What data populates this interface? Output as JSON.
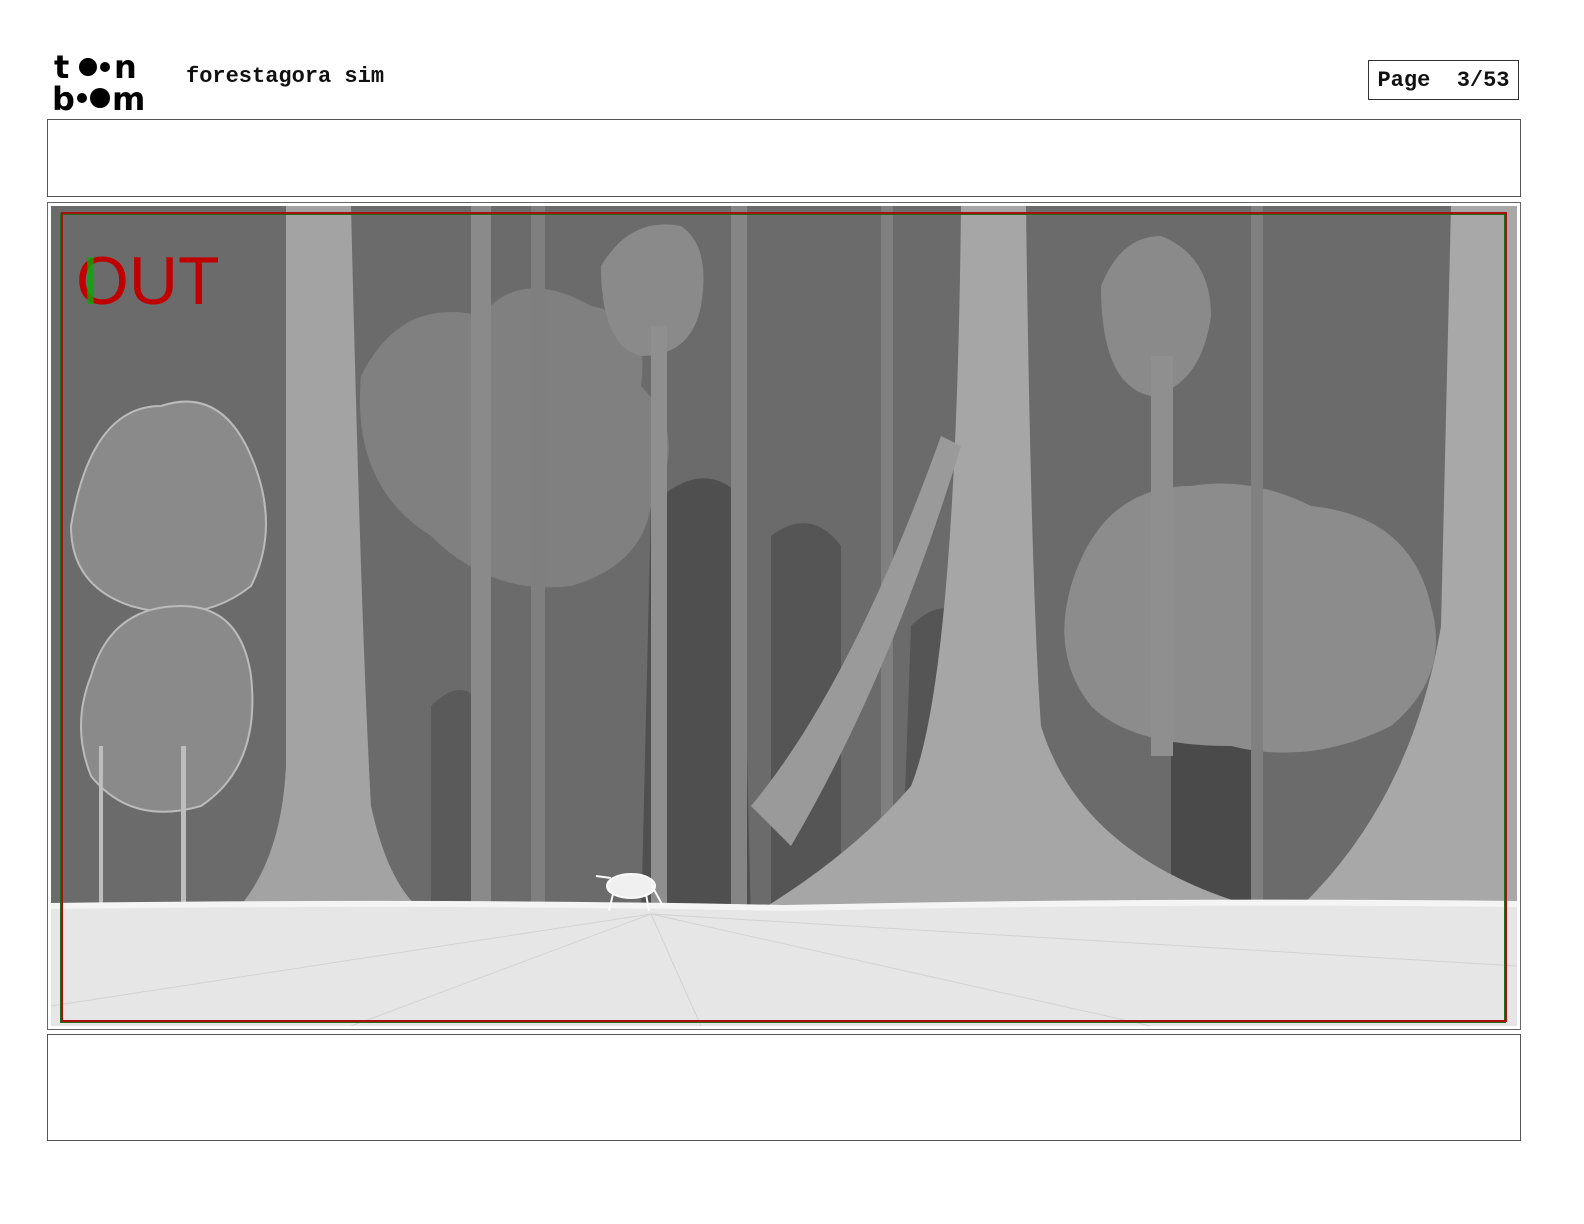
{
  "header": {
    "logo": {
      "line1": "toon",
      "line2": "boom",
      "icon": "toon-boom-logo"
    },
    "project_title": "forestagora sim",
    "page_label": "Page",
    "page_number": "3/53"
  },
  "panel": {
    "caption_top": "",
    "overlay_label": "OUT",
    "caption_bottom": ""
  },
  "colors": {
    "overlay_red": "#c00000",
    "overlay_green": "#00b000",
    "sky_dark": "#6b6b6b",
    "ground": "#e6e6e6"
  }
}
